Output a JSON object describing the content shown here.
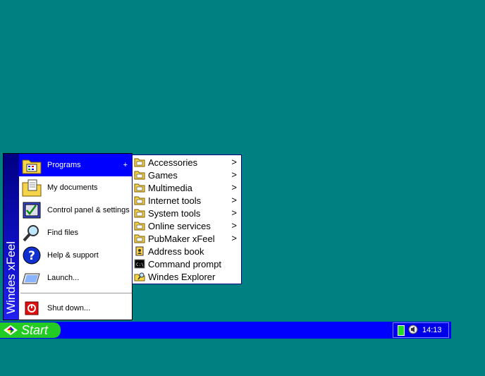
{
  "brand": "Windes xFeel",
  "start_menu": {
    "items": [
      {
        "label": "Programs",
        "icon": "programs-folder-icon",
        "arrow": "+"
      },
      {
        "label": "My documents",
        "icon": "documents-folder-icon"
      },
      {
        "label": "Control panel & settings",
        "icon": "control-panel-icon"
      },
      {
        "label": "Find files",
        "icon": "magnifier-icon"
      },
      {
        "label": "Help & support",
        "icon": "help-icon"
      },
      {
        "label": "Launch...",
        "icon": "run-icon"
      },
      {
        "label": "Shut down...",
        "icon": "power-icon"
      }
    ]
  },
  "programs_menu": {
    "items": [
      {
        "label": "Accessories",
        "arrow": ">"
      },
      {
        "label": "Games",
        "arrow": ">"
      },
      {
        "label": "Multimedia",
        "arrow": ">"
      },
      {
        "label": "Internet tools",
        "arrow": ">"
      },
      {
        "label": "System tools",
        "arrow": ">"
      },
      {
        "label": "Online services",
        "arrow": ">"
      },
      {
        "label": "PubMaker xFeel",
        "arrow": ">"
      },
      {
        "label": "Address book"
      },
      {
        "label": "Command prompt"
      },
      {
        "label": "Windes Explorer"
      }
    ]
  },
  "taskbar": {
    "start_label": "Start",
    "clock": "14:13"
  },
  "colors": {
    "desktop": "#008080",
    "taskbar": "#0000ff",
    "start_button": "#22cc22",
    "highlight": "#0000ff"
  }
}
